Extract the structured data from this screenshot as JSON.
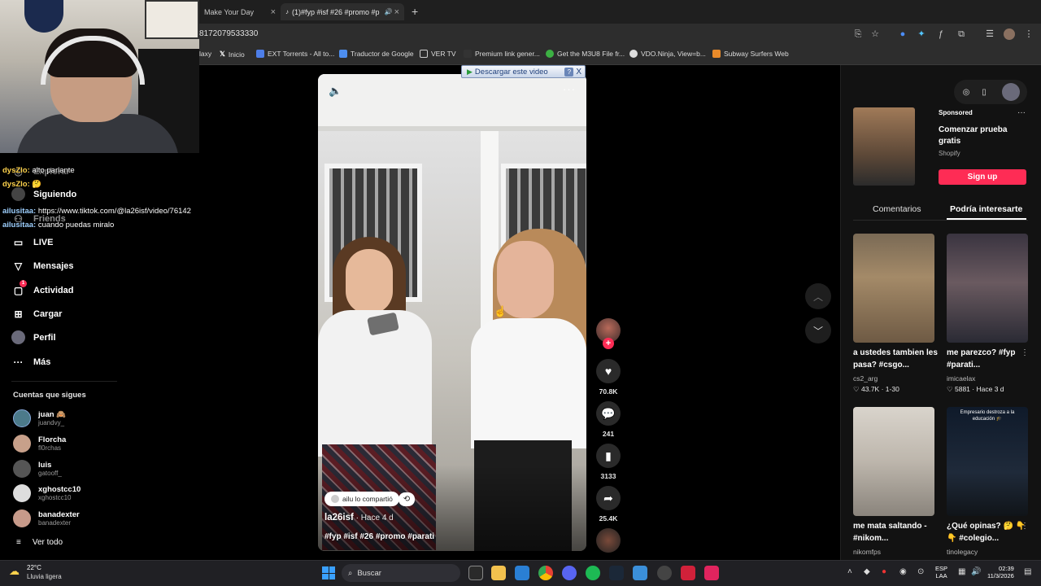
{
  "browser": {
    "tabs": [
      {
        "label": "Make Your Day",
        "close": "×"
      },
      {
        "label": "(1)#fyp #isf #26 #promo #p",
        "close": "×"
      }
    ],
    "new_tab": "+",
    "url": "8172079533330",
    "bookmarks": [
      {
        "label": "laxy"
      },
      {
        "label": "Inicio"
      },
      {
        "label": "EXT Torrents - All to..."
      },
      {
        "label": "Traductor de Google"
      },
      {
        "label": "VER TV"
      },
      {
        "label": "Premium link gener..."
      },
      {
        "label": "Get the M3U8 File fr..."
      },
      {
        "label": "VDO.Ninja, View=b..."
      },
      {
        "label": "Subway Surfers Web"
      }
    ]
  },
  "sidebar": {
    "nav": [
      {
        "label": "Siguiendo",
        "icon": "following-icon"
      },
      {
        "label": "Friends",
        "icon": "friends-icon"
      },
      {
        "label": "LIVE",
        "icon": "live-icon"
      },
      {
        "label": "Mensajes",
        "icon": "messages-icon"
      },
      {
        "label": "Actividad",
        "icon": "activity-icon",
        "badge": "1"
      },
      {
        "label": "Cargar",
        "icon": "upload-icon"
      },
      {
        "label": "Perfil",
        "icon": "profile-icon"
      },
      {
        "label": "Más",
        "icon": "more-icon"
      }
    ],
    "explore_partial": "Explorar",
    "following_title": "Cuentas que sigues",
    "accounts": [
      {
        "name": "juan 🙈",
        "handle": "juandvy_"
      },
      {
        "name": "Florcha",
        "handle": "fl0rchas"
      },
      {
        "name": "luis",
        "handle": "gatooff_"
      },
      {
        "name": "xghostcc10",
        "handle": "xghostcc10"
      },
      {
        "name": "banadexter",
        "handle": "banadexter"
      }
    ],
    "see_all": "Ver todo"
  },
  "chat": [
    {
      "user": "dysZlo:",
      "text": "alto parlante"
    },
    {
      "user": "dysZlo:",
      "text": "🤔"
    },
    {
      "user": "ailusitaa:",
      "text": "https://www.tiktok.com/@la26isf/video/76142"
    },
    {
      "user": "ailusitaa:",
      "text": "cuando puedas miralo"
    }
  ],
  "video": {
    "download_bar": "Descargar este video",
    "download_help": "?",
    "download_close": "X",
    "shared_chip": "ailu lo compartió",
    "author": "la26isf",
    "age": " · Hace 4 d",
    "caption": "#fyp #isf #26 #promo #parati",
    "likes": "70.8K",
    "comments": "241",
    "saves": "3133",
    "shares": "25.4K",
    "follow_plus": "+"
  },
  "right_panel": {
    "ad": {
      "sponsored": "Sponsored",
      "title": "Comenzar prueba gratis",
      "brand": "Shopify",
      "cta": "Sign up"
    },
    "tabs": [
      "Comentarios",
      "Podría interesarte"
    ],
    "recommendations": [
      {
        "title": "a ustedes tambien les pasa? #csgo...",
        "author": "cs2_arg",
        "likes": "43.7K",
        "age": "1-30"
      },
      {
        "title": "me parezco? #fyp #parati...",
        "author": "imicaelax",
        "likes": "5881",
        "age": "Hace 3 d"
      },
      {
        "title": "me mata saltando - #nikom...",
        "author": "nikomfps",
        "likes": "",
        "age": ""
      },
      {
        "title": "¿Qué opinas? 🤔 👇👇 #colegio...",
        "author": "tinolegacy",
        "likes": "",
        "age": ""
      }
    ],
    "rec_overlay_text": "Empresario destroza a la educación 🎓"
  },
  "taskbar": {
    "weather_temp": "22°C",
    "weather_desc": "Lluvia ligera",
    "search": "Buscar",
    "lang_top": "ESP",
    "lang_bottom": "LAA",
    "time": "02:39",
    "date": "11/3/2026"
  },
  "colors": {
    "accent": "#fe2c55",
    "background": "#000000",
    "panel": "#121212"
  }
}
